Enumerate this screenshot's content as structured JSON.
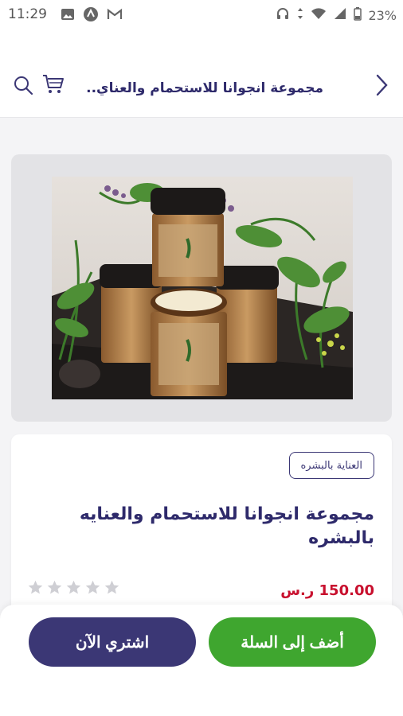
{
  "status_bar": {
    "time": "11:29",
    "battery": "23%",
    "left_icons": [
      "image-icon",
      "vpn-icon",
      "gmail-icon"
    ],
    "right_icons": [
      "headphones-icon",
      "data-arrows-icon",
      "wifi-icon",
      "signal-icon",
      "battery-icon"
    ]
  },
  "header": {
    "title": "مجموعة انجوانا للاستحمام والعناي..",
    "back_icon": "chevron-right-icon",
    "cart_icon": "cart-icon",
    "search_icon": "search-icon"
  },
  "product": {
    "category": "العناية بالبشره",
    "title": "مجموعة انجوانا للاستحمام والعنايه بالبشره",
    "price": "150.00 ر.س",
    "rating": 0,
    "max_rating": 5
  },
  "actions": {
    "add_to_cart": "أضف إلى السلة",
    "buy_now": "اشتري الآن"
  },
  "colors": {
    "primary": "#3b3775",
    "title": "#2e2a6b",
    "green": "#3fa62f",
    "price": "#c8102e",
    "star": "#cfcfd4"
  }
}
